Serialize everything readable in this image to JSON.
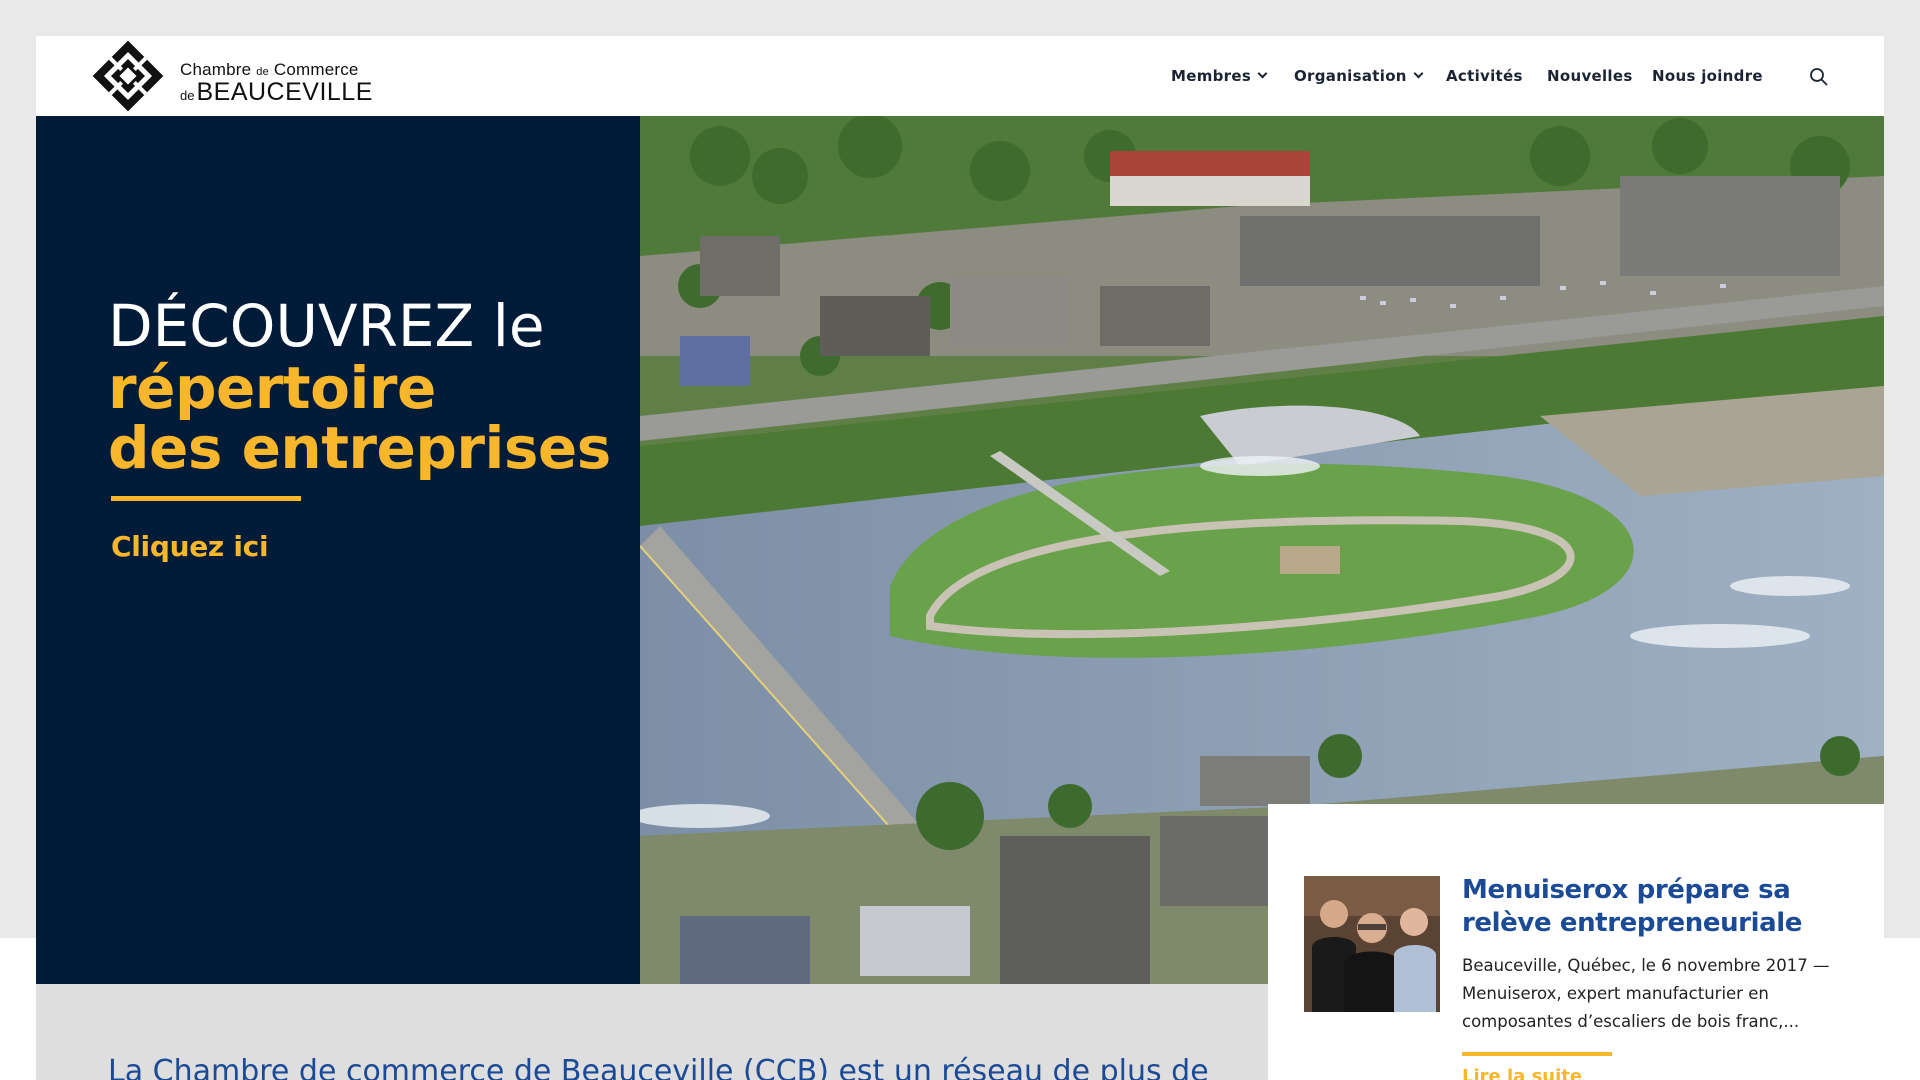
{
  "header": {
    "logo": {
      "line1_a": "Chambre",
      "line1_b": "de",
      "line1_c": "Commerce",
      "line2_a": "de",
      "line2_b": "BEAUCEVILLE"
    },
    "nav": [
      {
        "label": "Membres",
        "has_dropdown": true
      },
      {
        "label": "Organisation",
        "has_dropdown": true
      },
      {
        "label": "Activités",
        "has_dropdown": false
      },
      {
        "label": "Nouvelles",
        "has_dropdown": false
      },
      {
        "label": "Nous joindre",
        "has_dropdown": false
      }
    ],
    "search_icon": "search-icon"
  },
  "hero": {
    "line1": "DÉCOUVREZ le",
    "line2": "répertoire",
    "line3": "des entreprises",
    "cta": "Cliquez ici",
    "image": "aerial-photo-of-beauceville"
  },
  "intro": {
    "text": "La Chambre de commerce de Beauceville (CCB) est un réseau de plus de"
  },
  "news": {
    "title": "Menuiserox prépare sa relève entrepreneuriale",
    "excerpt": "Beauceville, Québec, le 6 novembre 2017 — Menuiserox, expert manufacturier en composantes d’escaliers de bois franc,...",
    "more": "Lire la suite",
    "photo": "team-photo"
  },
  "colors": {
    "navy": "#011b38",
    "accent": "#f8b62c",
    "link_blue": "#1b4a96",
    "page_bg": "#e9e9e9"
  }
}
